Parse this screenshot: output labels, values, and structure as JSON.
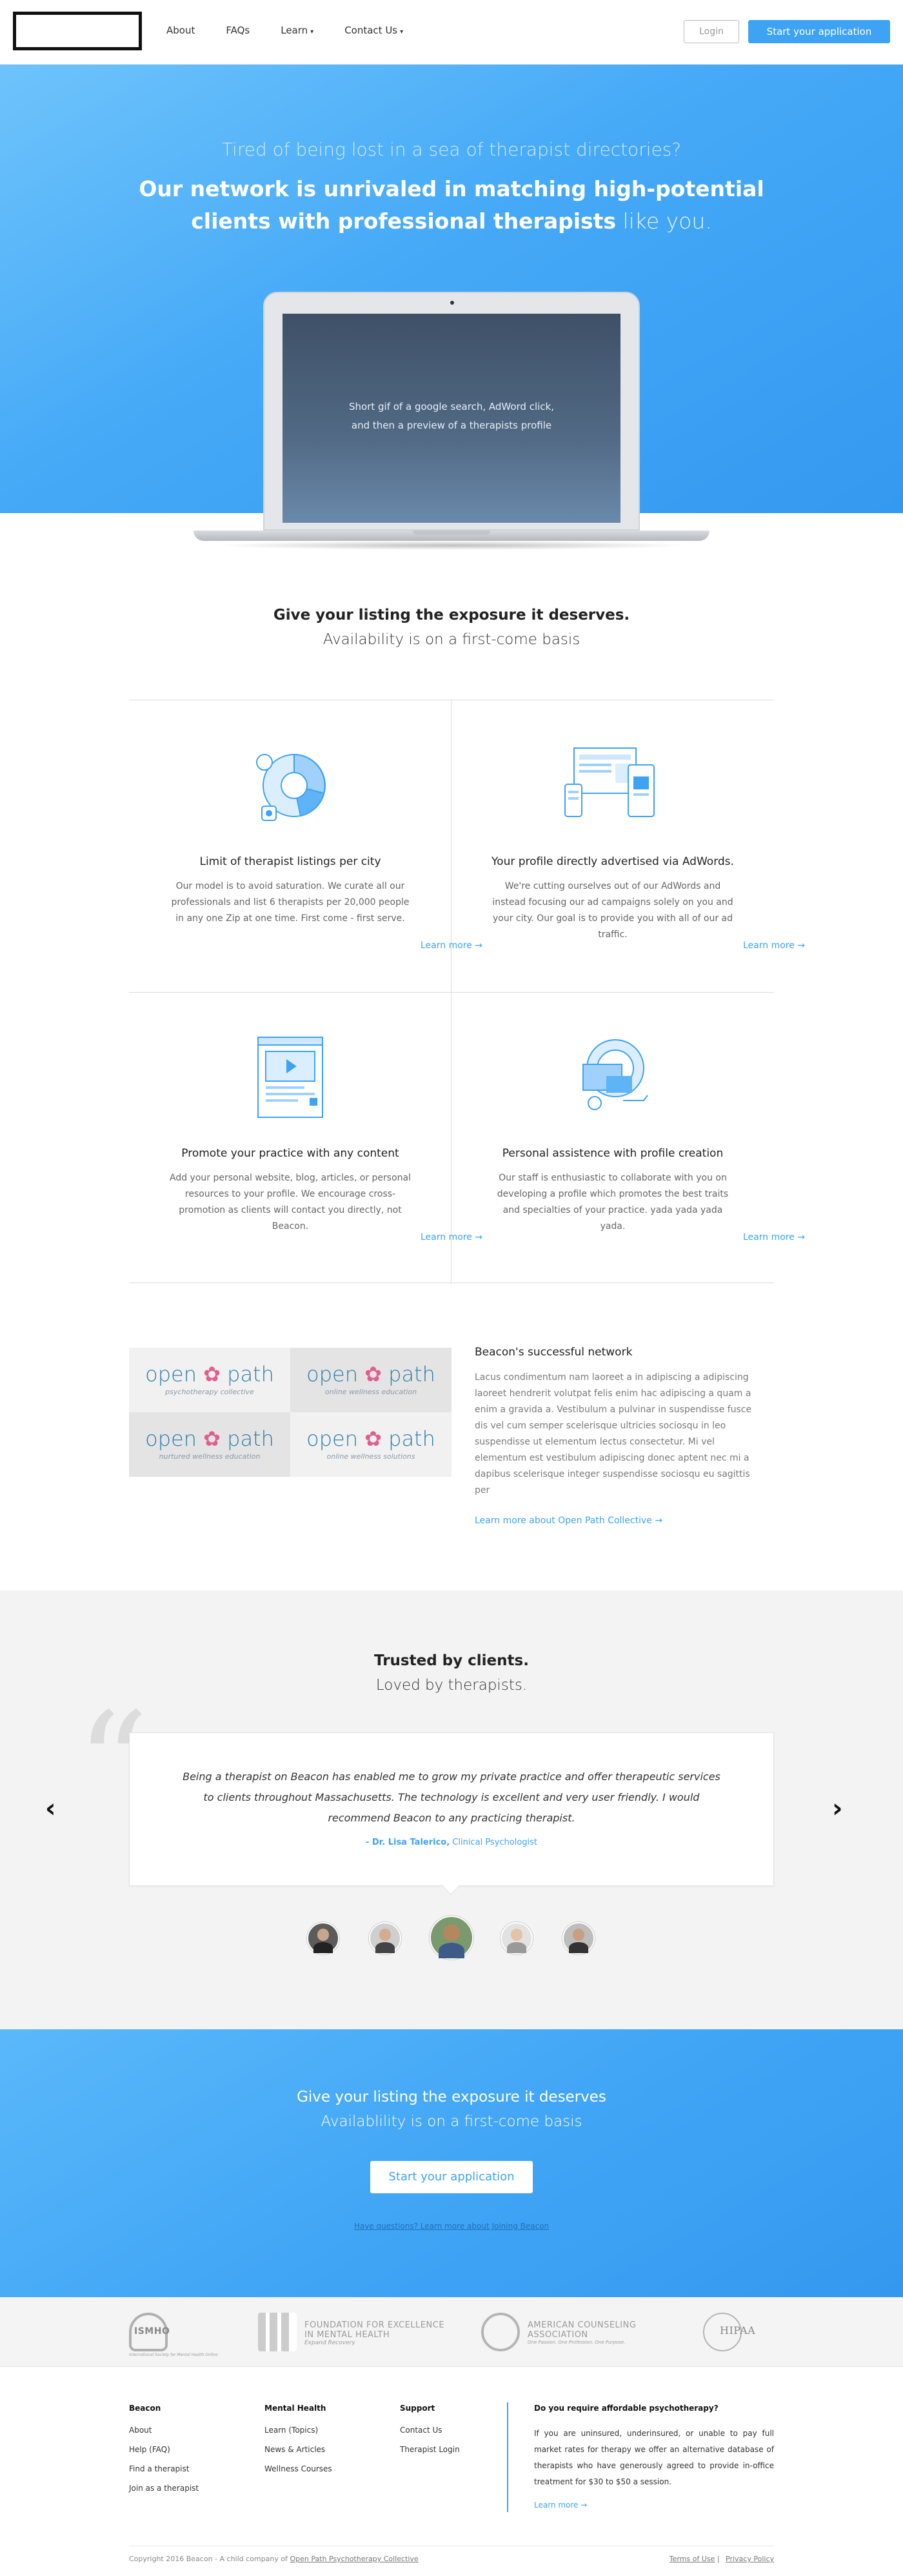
{
  "nav": {
    "links": [
      "About",
      "FAQs",
      "Learn",
      "Contact Us"
    ],
    "login": "Login",
    "start": "Start your application"
  },
  "hero": {
    "subtitle": "Tired of being lost in a sea of therapist directories?",
    "title_line1": "Our network is unrivaled in matching high-potential",
    "title_line2_bold": "clients with professional therapists",
    "title_line2_light": " like you.",
    "laptop_line1": "Short gif of a google search, AdWord click,",
    "laptop_line2": "and then a preview of a therapists profile"
  },
  "exposure": {
    "line1": "Give your listing the exposure it deserves.",
    "line2": "Availability is on a first-come basis"
  },
  "features": [
    {
      "title": "Limit of therapist listings per city",
      "body": "Our model is to avoid saturation. We curate all our professionals and list 6 therapists per 20,000 people in any one Zip at one time. First come - first serve.",
      "link": "Learn more →",
      "icon": "pie-chart-icon"
    },
    {
      "title": "Your profile directly advertised via AdWords.",
      "body": "We're cutting ourselves out of our AdWords and instead focusing our ad campaigns solely on you and your city. Our goal is to provide you with all of our ad traffic.",
      "link": "Learn more →",
      "icon": "devices-icon"
    },
    {
      "title": "Promote your practice with any content",
      "body": "Add your personal website, blog, articles, or personal resources to your profile. We encourage cross-promotion as clients will contact you directly, not Beacon.",
      "link": "Learn more →",
      "icon": "video-page-icon"
    },
    {
      "title": "Personal assistence with profile creation",
      "body": "Our staff is enthusiastic to collaborate with you on developing a profile which promotes the best traits and specialties of your practice. yada yada yada yada.",
      "link": "Learn more →",
      "icon": "profile-settings-icon"
    }
  ],
  "network": {
    "title": "Beacon's successful network",
    "body": "Lacus condimentum nam laoreet a in adipiscing a adipiscing laoreet hendrerit volutpat felis enim hac adipiscing a quam a enim a gravida a. Vestibulum a pulvinar in suspendisse fusce dis vel cum semper scelerisque ultricies sociosqu in leo suspendisse ut elementum lectus consectetur. Mi vel elementum est vestibulum adipiscing donec aptent nec mi a dapibus scelerisque integer suspendisse sociosqu eu sagittis per",
    "link": "Learn more about Open Path Collective →",
    "logos": [
      {
        "word_a": "open",
        "word_b": "path",
        "tag": "psychotherapy collective"
      },
      {
        "word_a": "open",
        "word_b": "path",
        "tag": "online wellness education"
      },
      {
        "word_a": "open",
        "word_b": "path",
        "tag": "nurtured wellness education"
      },
      {
        "word_a": "open",
        "word_b": "path",
        "tag": "online wellness solutions"
      }
    ]
  },
  "testimonials": {
    "line1": "Trusted by clients.",
    "line2": "Loved by therapists.",
    "quote": "Being a therapist on Beacon has enabled me to grow my private practice and offer therapeutic services to clients throughout Massachusetts. The technology is excellent and very user friendly. I would recommend Beacon to any practicing therapist.",
    "author": "- Dr. Lisa Talerico,",
    "role": " Clinical Psychologist"
  },
  "cta": {
    "line1": "Give your listing the exposure it deserves",
    "line2": "Availablility is on a first-come basis",
    "button": "Start your application",
    "question": "Have questions? Learn more about Joining Beacon"
  },
  "partners": [
    {
      "name": "ISMHO",
      "sub": "International Society for Mental Health Online"
    },
    {
      "name": "FOUNDATION FOR EXCELLENCE IN MENTAL HEALTH",
      "sub": "Expand Recovery"
    },
    {
      "name": "AMERICAN COUNSELING ASSOCIATION",
      "sub": "One Passion. One Profession. One Purpose."
    },
    {
      "name": "HIPAA",
      "sub": ""
    }
  ],
  "footer": {
    "col1": {
      "title": "Beacon",
      "items": [
        "About",
        "Help (FAQ)",
        "Find a therapist",
        "Join as a therapist"
      ]
    },
    "col2": {
      "title": "Mental Health",
      "items": [
        "Learn (Topics)",
        "News & Articles",
        "Wellness Courses"
      ]
    },
    "col3": {
      "title": "Support",
      "items": [
        "Contact Us",
        "Therapist Login"
      ]
    },
    "afford_title": "Do you require affordable psychotherapy?",
    "afford_body": "If you are uninsured, underinsured, or unable to pay full market rates for therapy we offer an alternative database of therapists who have generously agreed to provide in-office treatment for $30 to $50 a session.",
    "afford_link": "Learn more →",
    "copyright": "Copyright 2016 Beacon - A child company of ",
    "copyright_link": "Open Path Psychotherapy Collective",
    "terms": "Terms of Use",
    "privacy": "Privacy Policy"
  },
  "colors": {
    "accent": "#3ea3f5",
    "hero_top": "#6ec3fb",
    "hero_bottom": "#3499f0"
  }
}
